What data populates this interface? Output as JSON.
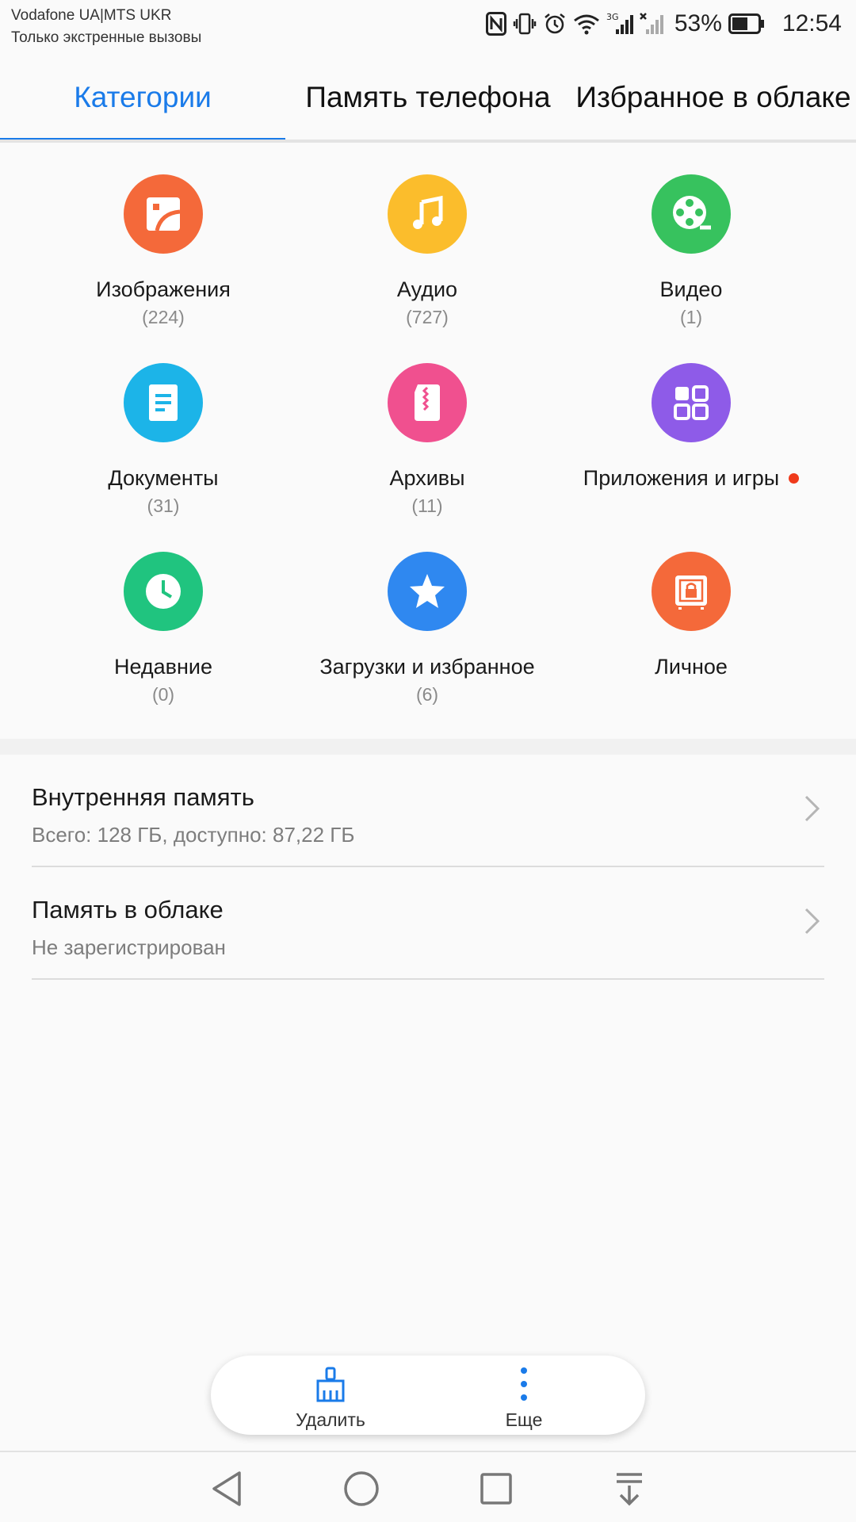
{
  "status_bar": {
    "carrier_line1": "Vodafone UA|MTS UKR",
    "carrier_line2": "Только экстренные вызовы",
    "battery_percent": "53%",
    "time": "12:54",
    "icons": [
      "nfc-icon",
      "vibrate-icon",
      "alarm-icon",
      "wifi-icon",
      "signal-3g-icon",
      "signal-no-sim-icon",
      "battery-icon"
    ]
  },
  "tabs": [
    {
      "label": "Категории",
      "active": true
    },
    {
      "label": "Память телефона",
      "active": false
    },
    {
      "label": "Избранное в облаке",
      "active": false
    }
  ],
  "categories": [
    {
      "label": "Изображения",
      "count": "(224)",
      "icon": "image-icon",
      "color": "#f4693a"
    },
    {
      "label": "Аудио",
      "count": "(727)",
      "icon": "music-note-icon",
      "color": "#fbbd2c"
    },
    {
      "label": "Видео",
      "count": "(1)",
      "icon": "film-reel-icon",
      "color": "#37c25e"
    },
    {
      "label": "Документы",
      "count": "(31)",
      "icon": "document-icon",
      "color": "#1cb4e8"
    },
    {
      "label": "Архивы",
      "count": "(11)",
      "icon": "archive-zip-icon",
      "color": "#f0508f"
    },
    {
      "label": "Приложения и игры",
      "count": "",
      "icon": "apps-grid-icon",
      "color": "#8e5be8",
      "badge_color": "#ef3a1b"
    },
    {
      "label": "Недавние",
      "count": "(0)",
      "icon": "clock-icon",
      "color": "#20c47f"
    },
    {
      "label": "Загрузки и избранное",
      "count": "(6)",
      "icon": "star-icon",
      "color": "#2f88f0"
    },
    {
      "label": "Личное",
      "count": "",
      "icon": "safe-lock-icon",
      "color": "#f4693a"
    }
  ],
  "storage": [
    {
      "title": "Внутренняя память",
      "subtitle": "Всего: 128 ГБ, доступно: 87,22 ГБ"
    },
    {
      "title": "Память в облаке",
      "subtitle": "Не зарегистрирован"
    }
  ],
  "action_bar": {
    "delete_label": "Удалить",
    "more_label": "Еще",
    "accent": "#1a7be9"
  },
  "navigation": {
    "buttons": [
      "back-icon",
      "home-icon",
      "recents-icon",
      "notifications-pull-icon"
    ]
  }
}
